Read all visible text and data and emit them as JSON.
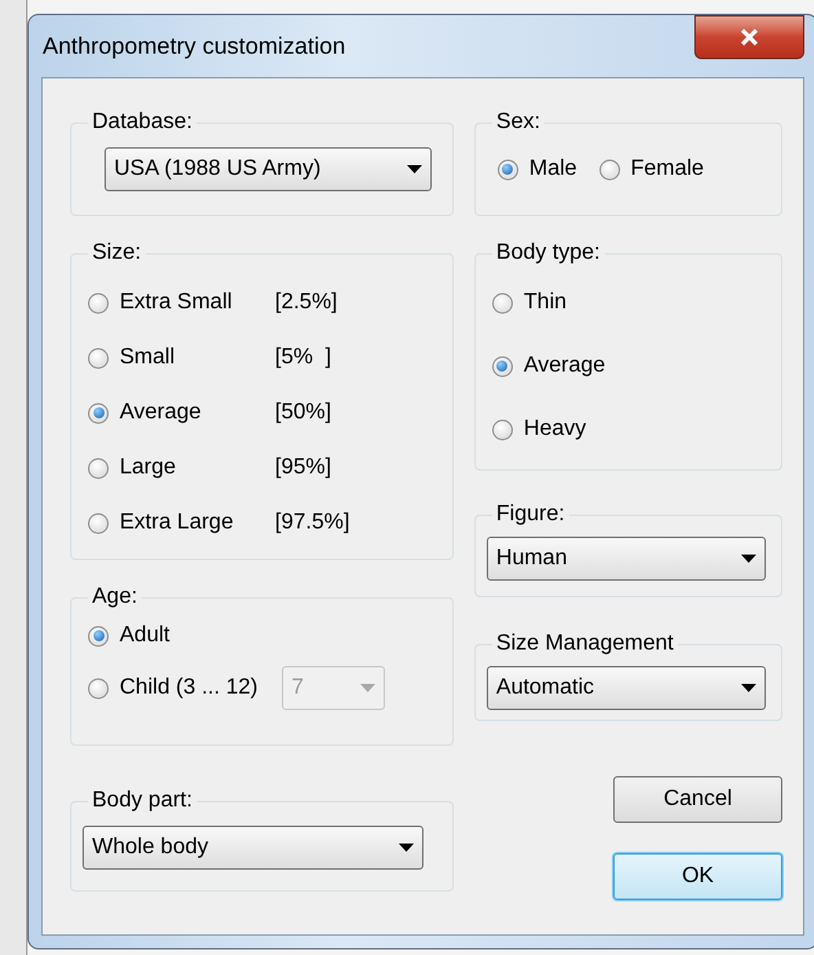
{
  "window": {
    "title": "Anthropometry customization"
  },
  "database": {
    "label": "Database:",
    "value": "USA (1988 US Army)"
  },
  "sex": {
    "label": "Sex:",
    "options": [
      {
        "label": "Male",
        "selected": true
      },
      {
        "label": "Female",
        "selected": false
      }
    ]
  },
  "size": {
    "label": "Size:",
    "options": [
      {
        "label": "Extra Small",
        "percent": "[2.5%]",
        "selected": false
      },
      {
        "label": "Small",
        "percent": "[5%  ]",
        "selected": false
      },
      {
        "label": "Average",
        "percent": "[50%]",
        "selected": true
      },
      {
        "label": "Large",
        "percent": "[95%]",
        "selected": false
      },
      {
        "label": "Extra Large",
        "percent": "[97.5%]",
        "selected": false
      }
    ]
  },
  "body_type": {
    "label": "Body type:",
    "options": [
      {
        "label": "Thin",
        "selected": false
      },
      {
        "label": "Average",
        "selected": true
      },
      {
        "label": "Heavy",
        "selected": false
      }
    ]
  },
  "figure": {
    "label": "Figure:",
    "value": "Human"
  },
  "age": {
    "label": "Age:",
    "options": [
      {
        "label": "Adult",
        "selected": true
      },
      {
        "label": "Child (3 ... 12)",
        "selected": false
      }
    ],
    "child_age": {
      "value": "7",
      "disabled": true
    }
  },
  "size_management": {
    "label": "Size Management",
    "value": "Automatic"
  },
  "body_part": {
    "label": "Body part:",
    "value": "Whole body"
  },
  "buttons": [
    {
      "label": "Cancel",
      "default": false
    },
    {
      "label": "OK",
      "default": true
    }
  ]
}
